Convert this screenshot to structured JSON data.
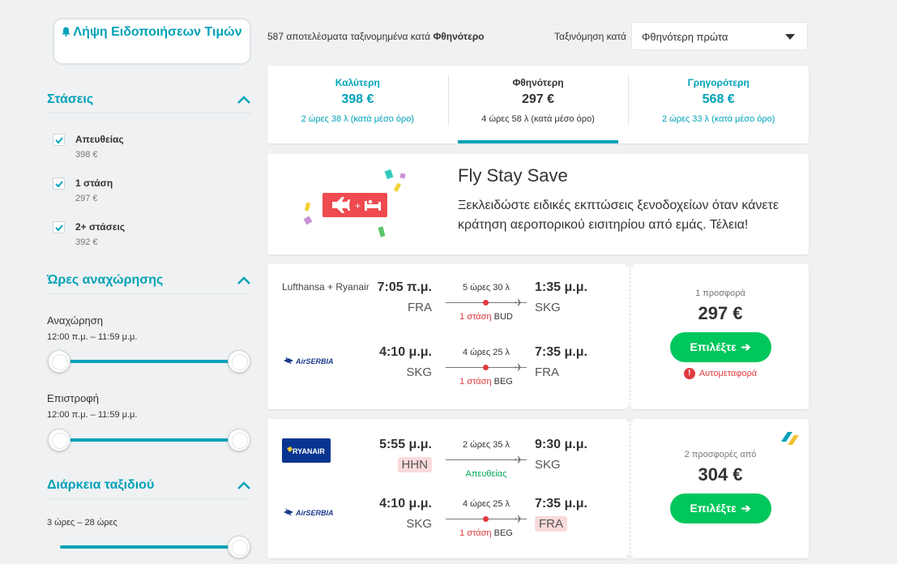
{
  "sidebar": {
    "alert_button": "Λήψη Ειδοποιήσεων Τιμών",
    "stops": {
      "title": "Στάσεις",
      "items": [
        {
          "label": "Απευθείας",
          "price": "398 €",
          "checked": true
        },
        {
          "label": "1 στάση",
          "price": "297 €",
          "checked": true
        },
        {
          "label": "2+ στάσεις",
          "price": "392 €",
          "checked": true
        }
      ]
    },
    "times": {
      "title": "Ώρες αναχώρησης",
      "departure_label": "Αναχώρηση",
      "departure_range": "12:00 π.μ. – 11:59 μ.μ.",
      "return_label": "Επιστροφή",
      "return_range": "12:00 π.μ. – 11:59 μ.μ."
    },
    "duration": {
      "title": "Διάρκεια ταξιδιού",
      "range": "3 ώρες – 28 ώρες"
    }
  },
  "topbar": {
    "count_prefix": "587 αποτελέσματα ταξινομημένα κατά",
    "count_sort": "Φθηνότερο",
    "sort_label": "Ταξινόμηση κατά",
    "sort_value": "Φθηνότερη πρώτα"
  },
  "tabs": [
    {
      "title": "Καλύτερη",
      "price": "398 €",
      "duration": "2 ώρες 38 λ (κατά μέσο όρο)"
    },
    {
      "title": "Φθηνότερη",
      "price": "297 €",
      "duration": "4 ώρες 58 λ (κατά μέσο όρο)"
    },
    {
      "title": "Γρηγορότερη",
      "price": "568 €",
      "duration": "2 ώρες 33 λ (κατά μέσο όρο)"
    }
  ],
  "promo": {
    "title": "Fly Stay Save",
    "text": "Ξεκλειδώστε ειδικές εκπτώσεις ξενοδοχείων όταν κάνετε κράτηση αεροπορικού εισιτηρίου από εμάς. Τέλεια!",
    "art_plus": "+"
  },
  "results": [
    {
      "outbound": {
        "airline": "Lufthansa + Ryanair",
        "dep_time": "7:05 π.μ.",
        "dep_code": "FRA",
        "duration": "5 ώρες 30 λ",
        "arr_time": "1:35 μ.μ.",
        "arr_code": "SKG",
        "stops": "1 στάση",
        "via": "BUD"
      },
      "inbound": {
        "airline_logo": "AirSERBIA",
        "dep_time": "4:10 μ.μ.",
        "dep_code": "SKG",
        "duration": "4 ώρες 25 λ",
        "arr_time": "7:35 μ.μ.",
        "arr_code": "FRA",
        "stops": "1 στάση",
        "via": "BEG"
      },
      "offers": "1 προσφορά",
      "price": "297 €",
      "button": "Επιλέξτε",
      "warning": "Αυτομεταφορά"
    },
    {
      "outbound": {
        "airline_logo": "RYANAIR",
        "dep_time": "5:55 μ.μ.",
        "dep_code": "HHN",
        "duration": "2 ώρες 35 λ",
        "arr_time": "9:30 μ.μ.",
        "arr_code": "SKG",
        "stops": "Απευθείας"
      },
      "inbound": {
        "airline_logo": "AirSERBIA",
        "dep_time": "4:10 μ.μ.",
        "dep_code": "SKG",
        "duration": "4 ώρες 25 λ",
        "arr_time": "7:35 μ.μ.",
        "arr_code": "FRA",
        "stops": "1 στάση",
        "via": "BEG"
      },
      "offers": "2 προσφορές από",
      "price": "304 €",
      "button": "Επιλέξτε"
    }
  ]
}
